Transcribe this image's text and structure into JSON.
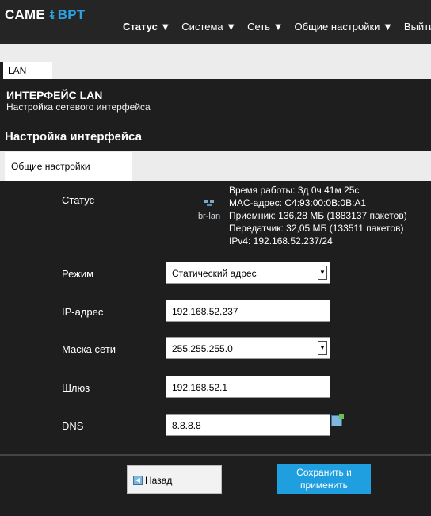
{
  "header": {
    "logo": {
      "came": "CAME",
      "bpt": "BPT",
      "tee": "ᵵ"
    },
    "nav": [
      {
        "label": "Статус ▼"
      },
      {
        "label": "Система ▼"
      },
      {
        "label": "Сеть ▼"
      },
      {
        "label": "Общие настройки ▼"
      },
      {
        "label": "Выйти"
      }
    ]
  },
  "tabs": {
    "lan": "LAN"
  },
  "page": {
    "title": "ИНТЕРФЕЙС LAN",
    "subtitle": "Настройка сетевого интерфейса",
    "section_title": "Настройка интерфейса",
    "subtab": "Общие настройки"
  },
  "status": {
    "label": "Статус",
    "icon_caption": "br-lan",
    "lines": [
      "Время работы: 3д 0ч 41м 25с",
      "MAC-адрес: C4:93:00:0B:0B:A1",
      "Приемник: 136,28 МБ (1883137 пакетов)",
      "Передатчик: 32,05 МБ (133511 пакетов)",
      "IPv4: 192.168.52.237/24"
    ]
  },
  "form": {
    "mode": {
      "label": "Режим",
      "value": "Статический адрес"
    },
    "ip": {
      "label": "IP-адрес",
      "value": "192.168.52.237"
    },
    "mask": {
      "label": "Маска сети",
      "value": "255.255.255.0"
    },
    "gateway": {
      "label": "Шлюз",
      "value": "192.168.52.1"
    },
    "dns": {
      "label": "DNS",
      "value": "8.8.8.8"
    }
  },
  "buttons": {
    "back": "Назад",
    "save": "Сохранить и применить"
  },
  "colors": {
    "accent": "#1f9ee0",
    "background": "#1e1e1e"
  },
  "icons": [
    "network-icon",
    "add-icon",
    "back-icon",
    "dropdown-arrow-icon"
  ]
}
